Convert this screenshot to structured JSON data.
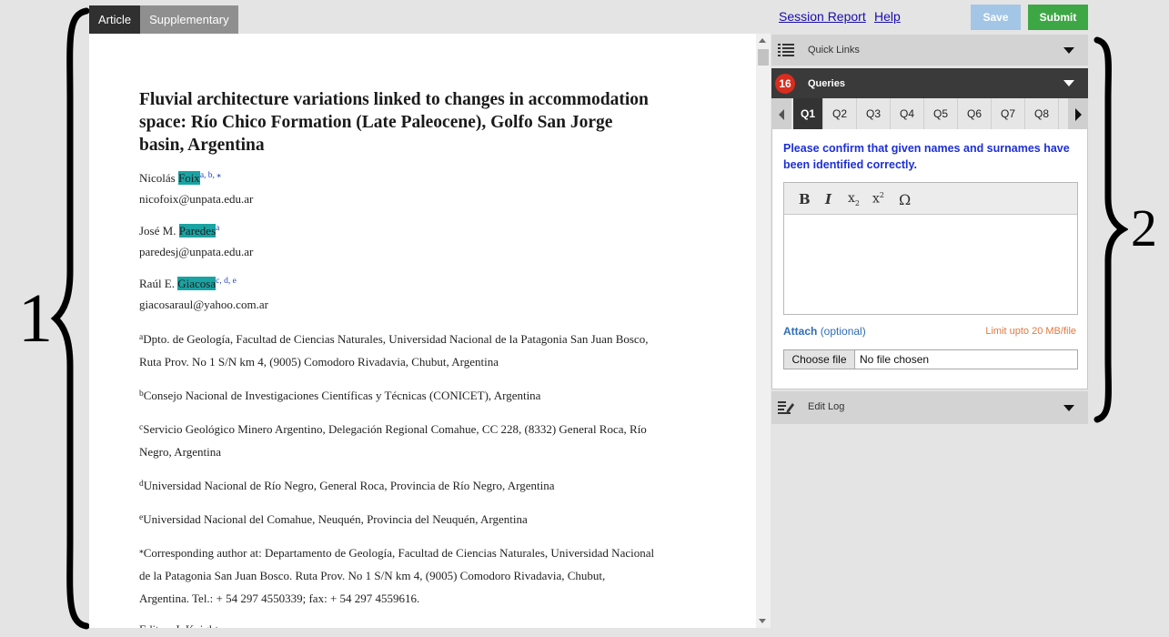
{
  "annotations": {
    "left_label": "1",
    "right_label": "2"
  },
  "tabs": [
    {
      "label": "Article"
    },
    {
      "label": "Supplementary"
    }
  ],
  "header": {
    "session_report": "Session Report",
    "help": "Help",
    "save": "Save",
    "submit": "Submit"
  },
  "article": {
    "title_lines": [
      "Fluvial architecture variations linked to changes in accommodation",
      "space: Río Chico Formation (Late Paleocene), Golfo San Jorge",
      "basin, Argentina"
    ],
    "authors": [
      {
        "first": "Nicolás ",
        "last": "Foix",
        "sup": "a, b, ",
        "star": "⁎",
        "email": "nicofoix@unpata.edu.ar"
      },
      {
        "first": "José M. ",
        "last": "Paredes",
        "sup": "a",
        "star": "",
        "email": "paredesj@unpata.edu.ar"
      },
      {
        "first": "Raúl E. ",
        "last": "Giacosa",
        "sup": "c, d, e",
        "star": "",
        "email": "giacosaraul@yahoo.com.ar"
      }
    ],
    "affiliations": [
      {
        "mark": "a",
        "lines": [
          "Dpto. de Geología, Facultad de Ciencias Naturales, Universidad Nacional de la Patagonia San Juan Bosco,",
          "Ruta Prov. No 1 S/N km 4, (9005) Comodoro Rivadavia, Chubut, Argentina"
        ]
      },
      {
        "mark": "b",
        "lines": [
          "Consejo Nacional de Investigaciones Científicas y Técnicas (CONICET), Argentina"
        ]
      },
      {
        "mark": "c",
        "lines": [
          "Servicio Geológico Minero Argentino, Delegación Regional Comahue, CC 228, (8332) General Roca, Río",
          "Negro, Argentina"
        ]
      },
      {
        "mark": "d",
        "lines": [
          "Universidad Nacional de Río Negro, General Roca, Provincia de Río Negro, Argentina"
        ]
      },
      {
        "mark": "e",
        "lines": [
          "Universidad Nacional del Comahue, Neuquén, Provincia del Neuquén, Argentina"
        ]
      }
    ],
    "corresponding": {
      "mark": "⁎",
      "lines": [
        "Corresponding author at: Departamento de Geología, Facultad de Ciencias Naturales, Universidad Nacional",
        "de la Patagonia San Juan Bosco. Ruta Prov. No 1 S/N km 4, (9005) Comodoro Rivadavia, Chubut,",
        "Argentina. Tel.: + 54 297 4550339; fax: + 54 297 4559616."
      ]
    },
    "editor": "Editor: J. Knight"
  },
  "panel": {
    "quick_links": "Quick Links",
    "queries": "Queries",
    "query_count": "16",
    "query_tabs": [
      "Q1",
      "Q2",
      "Q3",
      "Q4",
      "Q5",
      "Q6",
      "Q7",
      "Q8"
    ],
    "active_query": "Q1",
    "query_text": "Please confirm that given names and surnames have been identified correctly.",
    "toolbar": {
      "bold": "B",
      "italic": "I",
      "subscript": "x",
      "superscript": "x",
      "omega": "Ω"
    },
    "attach": "Attach",
    "attach_optional": "(optional)",
    "limit": "Limit upto 20 MB/file",
    "choose_file": "Choose file",
    "no_file": "No file chosen",
    "edit_log": "Edit Log"
  },
  "colors": {
    "highlight": "#1aa3a3",
    "submit": "#3ea745",
    "save": "#a3c6e6",
    "badge": "#d92d1f",
    "query_text": "#1d2fd6"
  }
}
